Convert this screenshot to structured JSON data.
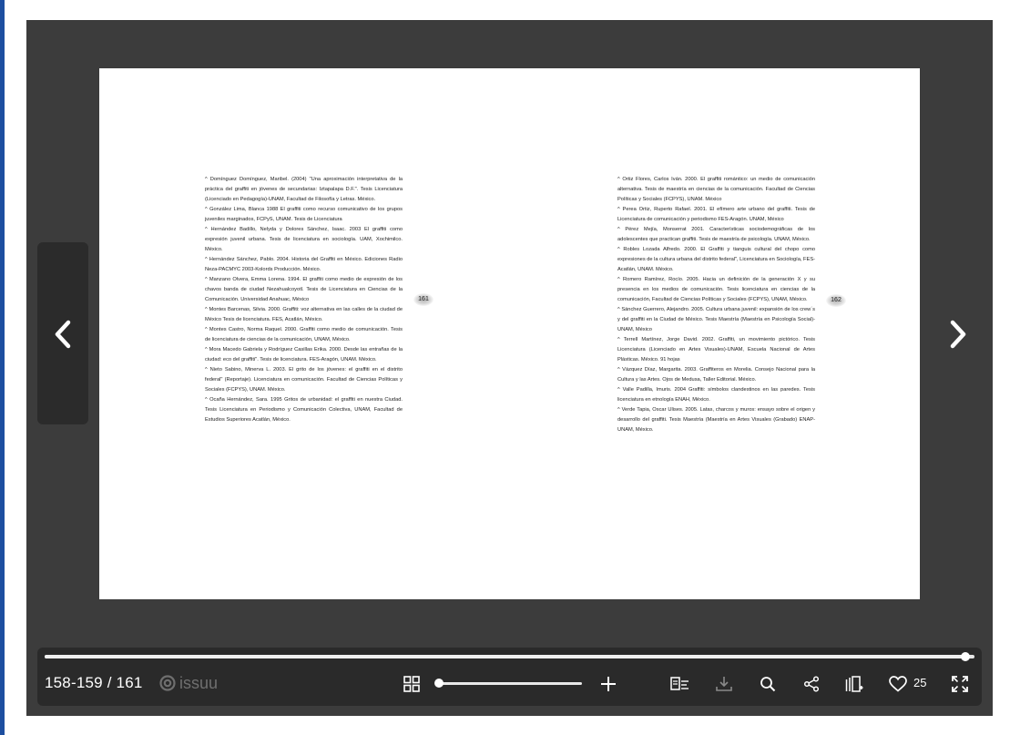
{
  "viewer": {
    "left_page_number": "161",
    "right_page_number": "162",
    "left_page_lines": [
      "^ Domínguez Domínguez, Maribel. (2004) \"Una aproximación interpretativa de la práctica del graffiti en jóvenes de secundarias: Iztapalapa D.F.\". Tesis Licenciatura (Licenciado en Pedagogía)-UNAM, Facultad de Filosofía y Letras. México.",
      "^ González Lima, Blanca 1988 El graffiti como recurso comunicativo de los grupos juveniles marginados, FCPyS, UNAM. Tesis de Licenciatura",
      "^ Hernández Badillo, Nelyda y Dolores Sánchez, Isaac. 2003 El graffiti como expresión juvenil urbana. Tesis de licenciatura en sociología. UAM, Xochimilco. México.",
      "^ Hernández Sánchez, Pablo. 2004. Historia del Graffiti en México. Ediciones Radio Neza-PACMYC 2003-Kolords Producción. México.",
      "^ Manzano Olvera, Emma Lorena. 1994. El graffiti como medio de expresión de los chavos banda de ciudad Nezahualcoyotl. Tesis de Licenciatura en Ciencias de la Comunicación. Universidad Anahuac, México",
      "^  Montes Barcenas, Silvia. 2000. Graffiti: voz alternativa en las calles de la ciudad de México Tesis de licenciatura. FES, Acatlán, México.",
      "^ Montes Castro, Norma Raquel. 2000. Graffiti como medio de comunicación. Tesis de licenciatura de ciencias de la comunicación, UNAM, México.",
      "^ Mora Macedo Gabriela y  Rodríguez Casillas Erika.  2000. Desde las entrañas de la ciudad: eco del graffiti\". Tesis de licenciatura. FES-Aragón, UNAM. México.",
      "^ Nieto Sabino, Minerva L. 2003. El grito de los jóvenes: el graffiti en el distrito federal\" (Reportaje). Licenciatura en comunicación. Facultad de Ciencias Políticas y Sociales (FCPYS), UNAM. México.",
      "^  Ocaña Hernández, Sara. 1995 Gritos de urbanidad: el graffiti en nuestra Ciudad. Tesis Licenciatura en Periodismo y Comunicación Colectiva, UNAM, Facultad de Estudios Superiores Acatlán, México."
    ],
    "right_page_lines": [
      "^ Ortiz Flores, Carlos Iván. 2000. El graffiti romántico: un medio de comunicación alternativa. Tesis de maestría en ciencias de la comunicación. Facultad de Ciencias Políticas y Sociales (FCPYS), UNAM. México",
      "^ Perea Ortiz, Ruperto Rafael. 2001. El efímero arte urbano del graffiti. Tesis de Licenciatura de comunicación y periodismo FES-Aragón. UNAM, México",
      "^  Pérez Mejía, Monserrat 2001. Características sociodemográficas de los adolescentes que practican graffiti. Tesis de maestría de psicología. UNAM, México.",
      "^ Robles Lozada Alfredo. 2000. El Graffiti y tianguis cultural del chopo como expresiones de la cultura urbana del distrito federal\", Licenciatura en Sociología, FES-Acatlán, UNAM. México.",
      "^ Romero Ramírez, Rocío. 2005. Hacia un definición de la generación X y su presencia en los medios de comunicación. Tesis licenciatura en ciencias de la comunicación, Facultad de Ciencias Políticas y Sociales (FCPYS), UNAM, México.",
      "^  Sánchez Guerrero, Alejandro. 2005. Cultura urbana juvenil: expansión de los crew´s y del graffiti en la Ciudad de México. Tesis Maestría (Maestría en Psicología Social)-UNAM, México",
      "^ Terrell Martínez, Jorge David. 2002. Graffiti, un movimiento pictórico. Tesis Licenciatura (Licenciado en Artes Visuales)-UNAM, Escuela Nacional de Artes Plásticas. México. 91 hojas",
      "^ Vázquez Díaz, Margarita. 2003. Graffiteros en Morelia. Consejo Nacional para la Cultura y las Artes. Ojos de Medusa, Taller Editorial. México.",
      "^ Valle Padilla, Imuris. 2004 Graffiti: símbolos clandestinos en las paredes. Tesis licenciatura en etnología ENAH, México.",
      "^ Verde Tapia, Oscar Ulises. 2005. Latas, charcos y muros: ensayo sobre el origen y desarrollo del graffiti. Tesis Maestría (Maestría en Artes Visuales (Grabado) ENAP-UNAM, México."
    ]
  },
  "navigation": {
    "prev_icon": "chevron-left-icon",
    "next_icon": "chevron-right-icon"
  },
  "toolbar": {
    "page_indicator": "158-159 / 161",
    "brand": "issuu",
    "progress_fraction": 0.99,
    "zoom_fraction": 0.0,
    "like_count": "25",
    "icons": [
      "grid-view-icon",
      "zoom-in-icon",
      "reader-mode-icon",
      "download-icon",
      "search-icon",
      "share-icon",
      "add-to-stack-icon",
      "heart-icon",
      "fullscreen-icon"
    ]
  },
  "colors": {
    "viewer_bg": "#3c3c3c",
    "toolbar_bg": "#2a2a2a",
    "icon_color": "#ffffff",
    "download_disabled": "#8a8a8a",
    "brand_gray": "#6f6f6f"
  }
}
